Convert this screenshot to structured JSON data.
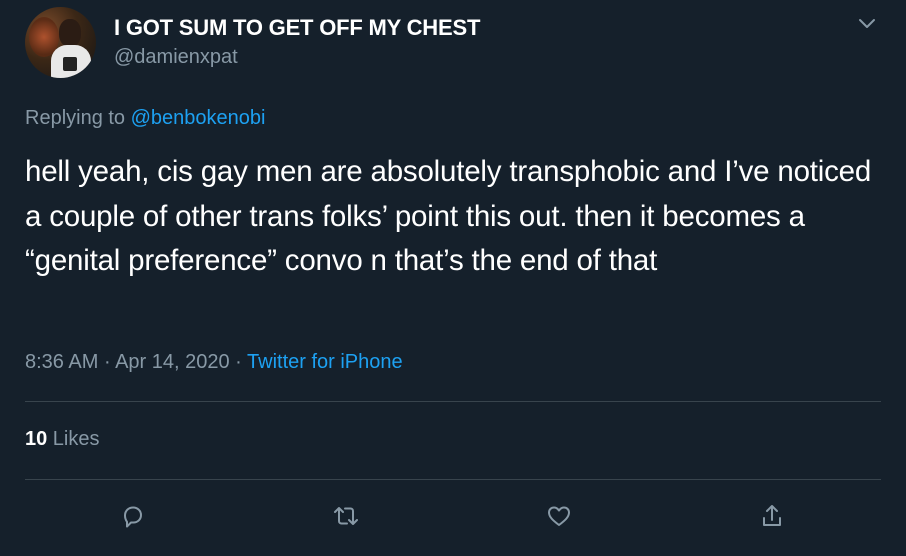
{
  "user": {
    "display_name": "I GOT SUM TO GET OFF MY CHEST",
    "handle": "@damienxpat"
  },
  "reply": {
    "prefix": "Replying to ",
    "to_handle": "@benbokenobi"
  },
  "tweet": {
    "text": "hell yeah, cis gay men are absolutely transphobic and I’ve noticed a couple of other trans folks’ point this out. then it becomes a “genital preference” convo n that’s the end of that"
  },
  "meta": {
    "time": "8:36 AM",
    "separator1": " · ",
    "date": "Apr 14, 2020",
    "separator2": " · ",
    "source": "Twitter for iPhone"
  },
  "stats": {
    "likes_count": "10",
    "likes_label": " Likes"
  },
  "icons": {
    "menu": "chevron-down-icon",
    "reply": "reply-icon",
    "retweet": "retweet-icon",
    "like": "heart-icon",
    "share": "share-icon"
  },
  "colors": {
    "background": "#15202b",
    "text_primary": "#ffffff",
    "text_secondary": "#8899a6",
    "accent": "#1da1f2",
    "divider": "#38444d"
  }
}
